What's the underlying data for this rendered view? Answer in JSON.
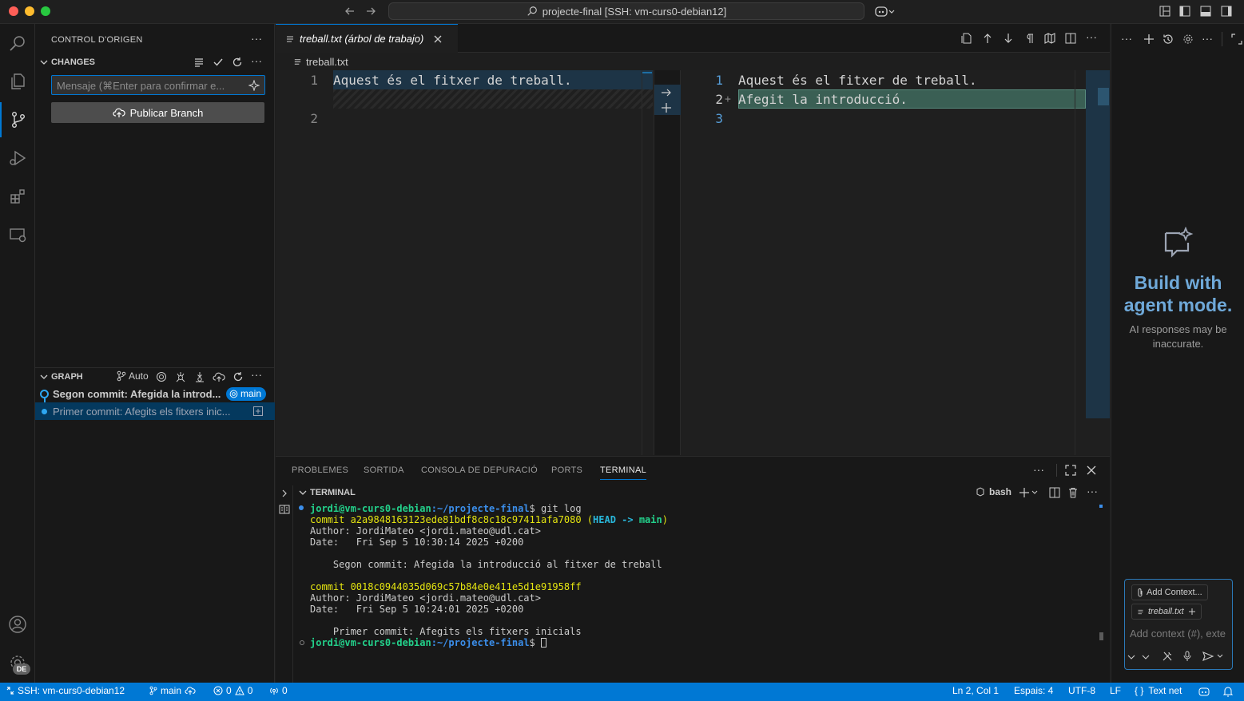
{
  "window": {
    "title": "projecte-final [SSH: vm-curs0-debian12]"
  },
  "activity_bar": {
    "items": [
      "search-icon",
      "explorer-icon",
      "source-control-icon",
      "run-debug-icon",
      "extensions-icon",
      "remote-explorer-icon"
    ],
    "account_badge": "DE"
  },
  "sidebar": {
    "title": "CONTROL D'ORIGEN",
    "changes_label": "CHANGES",
    "commit_placeholder": "Mensaje (⌘Enter para confirmar e...",
    "publish_button": "Publicar Branch",
    "graph_label": "GRAPH",
    "graph_auto": "Auto",
    "commits": [
      {
        "message": "Segon commit: Afegida la introd...",
        "badge": "main"
      },
      {
        "message": "Primer commit: Afegits els fitxers inic..."
      }
    ]
  },
  "editor": {
    "tab_label": "treball.txt (árbol de trabajo)",
    "breadcrumb": "treball.txt",
    "left": {
      "lines": [
        {
          "num": "1",
          "text": "Aquest és el fitxer de treball."
        },
        {
          "num": "2",
          "text": ""
        }
      ]
    },
    "right": {
      "lines": [
        {
          "num": "1",
          "text": "Aquest és el fitxer de treball."
        },
        {
          "num": "2",
          "marker": "+",
          "text": "Afegit la introducció."
        },
        {
          "num": "3",
          "text": ""
        }
      ]
    }
  },
  "panel": {
    "tabs": [
      "PROBLEMES",
      "SORTIDA",
      "CONSOLA DE DEPURACIÓ",
      "PORTS",
      "TERMINAL"
    ],
    "active_tab": "TERMINAL",
    "terminal_label": "TERMINAL",
    "shell": "bash",
    "terminal": {
      "prompt_user": "jordi@vm-curs0-debian",
      "prompt_path": ":~/projecte-final",
      "command": "$ git log",
      "commit1": "commit a2a9848163123ede81bdf8c8c18c97411afa7080",
      "commit1_refs_open": " (",
      "commit1_head": "HEAD -> ",
      "commit1_branch": "main",
      "commit1_refs_close": ")",
      "author1": "Author: JordiMateo <jordi.mateo@udl.cat>",
      "date1": "Date:   Fri Sep 5 10:30:14 2025 +0200",
      "msg1": "    Segon commit: Afegida la introducció al fitxer de treball",
      "commit2": "commit 0018c0944035d069c57b84e0e411e5d1e91958ff",
      "author2": "Author: JordiMateo <jordi.mateo@udl.cat>",
      "date2": "Date:   Fri Sep 5 10:24:01 2025 +0200",
      "msg2": "    Primer commit: Afegits els fitxers inicials",
      "prompt2_end": "$ "
    }
  },
  "chat": {
    "title": "Build with agent mode.",
    "subtitle": "AI responses may be inaccurate.",
    "add_context": "Add Context...",
    "file_chip": "treball.txt",
    "input_placeholder": "Add context (#), exte"
  },
  "status_bar": {
    "remote": "SSH: vm-curs0-debian12",
    "branch": "main",
    "errors": "0",
    "warnings": "0",
    "ports": "0",
    "position": "Ln 2, Col 1",
    "spaces": "Espais: 4",
    "encoding": "UTF-8",
    "eol": "LF",
    "language": "Text net"
  },
  "colors": {
    "accent": "#0078d4",
    "status_bar": "#0078d4",
    "terminal_green": "#23d18b",
    "terminal_blue": "#3b8eea",
    "terminal_yellow": "#e5e510",
    "terminal_cyan": "#29b8db",
    "diff_inserted": "#3a5f54"
  }
}
